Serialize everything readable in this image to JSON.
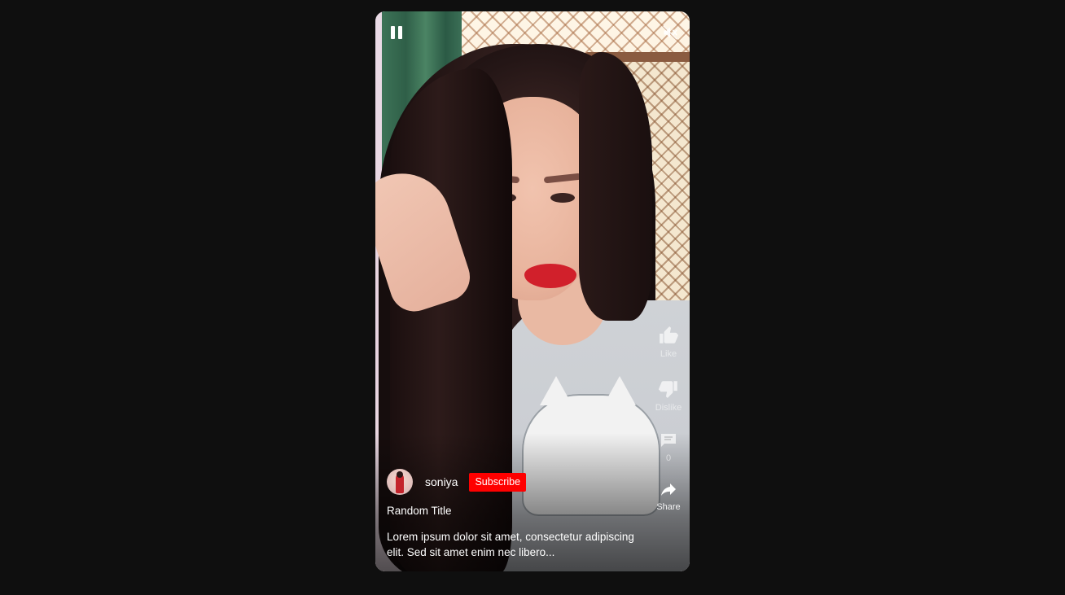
{
  "player": {
    "pause_icon": "pause-icon",
    "mute_icon": "volume-muted-icon"
  },
  "actions": {
    "like_label": "Like",
    "dislike_label": "Dislike",
    "comment_count": "0",
    "share_label": "Share"
  },
  "channel": {
    "name": "soniya",
    "subscribe_label": "Subscribe"
  },
  "video": {
    "title": "Random Title",
    "description": "Lorem ipsum dolor sit amet, consectetur adipiscing elit. Sed sit amet enim nec libero..."
  },
  "colors": {
    "page_background": "#0f0f0f",
    "subscribe_red": "#ff0000"
  }
}
